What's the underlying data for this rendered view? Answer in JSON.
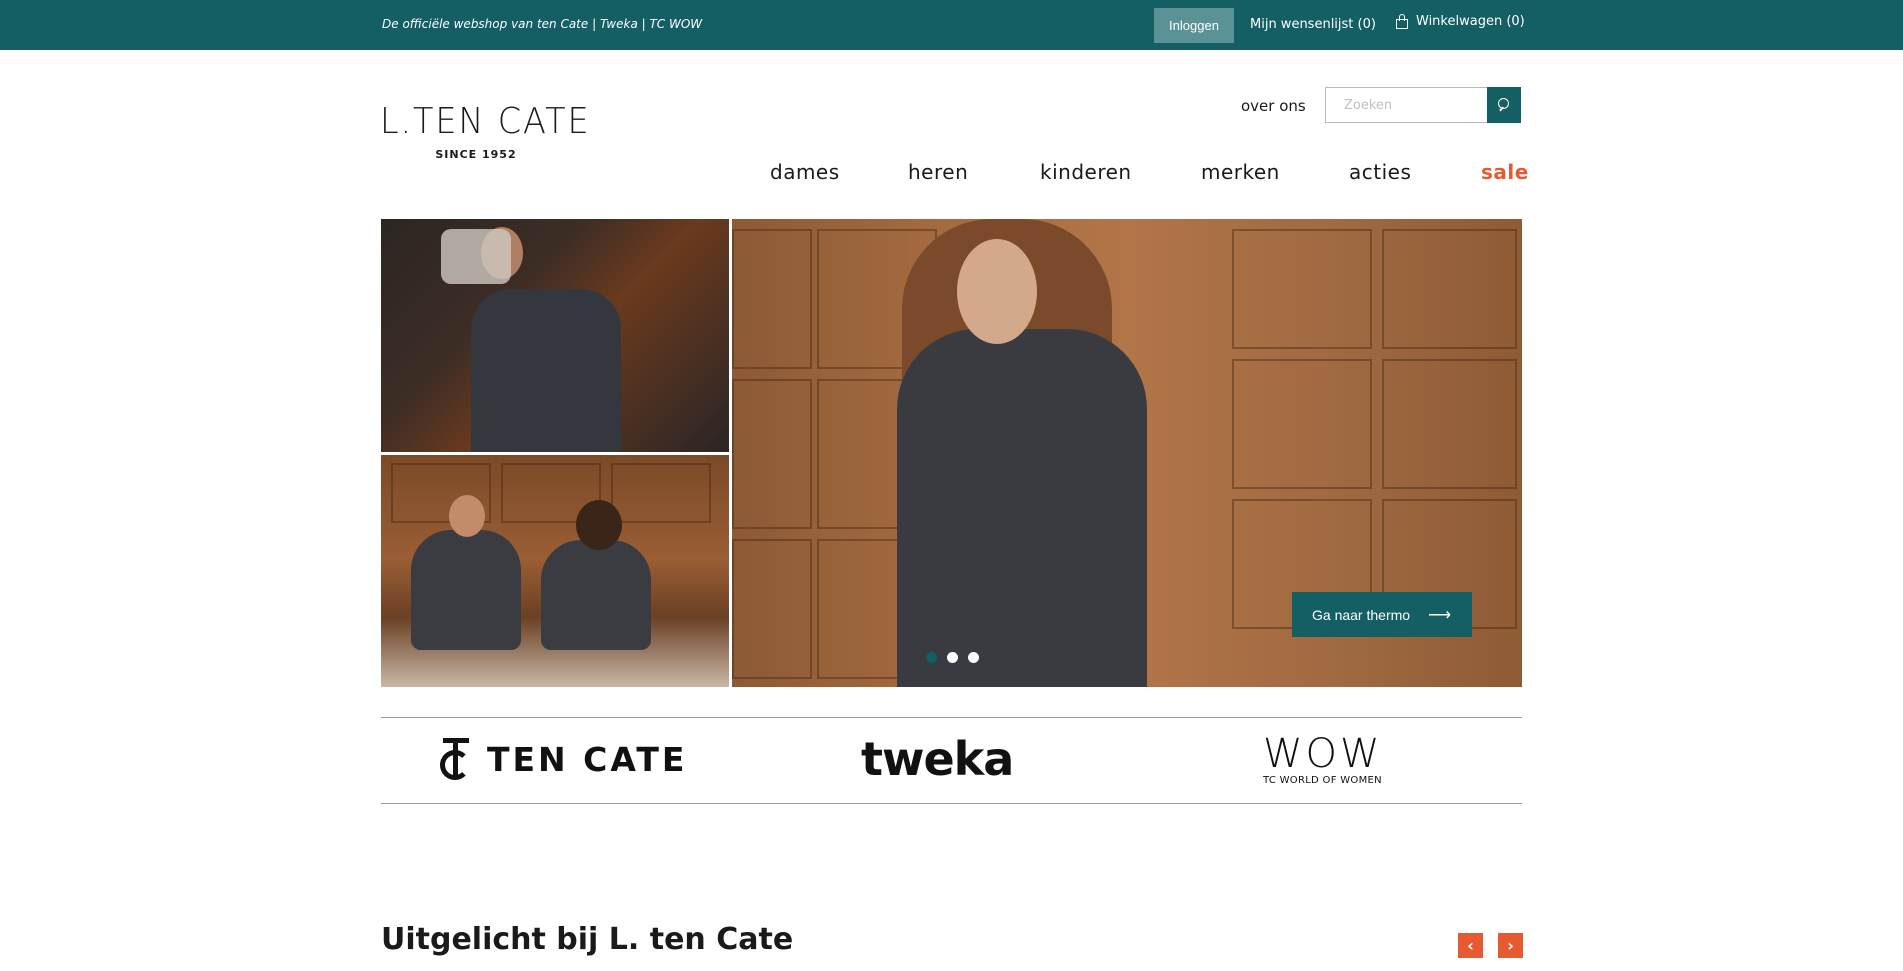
{
  "topbar": {
    "tagline": "De officiële webshop van ten Cate | Tweka | TC WOW",
    "login_label": "Inloggen",
    "wishlist_label": "Mijn wensenlijst (0)",
    "cart_label": "Winkelwagen (0)"
  },
  "header": {
    "logo_brand": "L.TEN CATE",
    "logo_since": "SINCE 1952",
    "about_label": "over ons",
    "search_placeholder": "Zoeken"
  },
  "nav": {
    "items": [
      {
        "label": "dames"
      },
      {
        "label": "heren"
      },
      {
        "label": "kinderen"
      },
      {
        "label": "merken"
      },
      {
        "label": "acties"
      },
      {
        "label": "sale"
      }
    ]
  },
  "hero": {
    "cta_label": "Ga naar thermo",
    "cta_arrow": "⟶",
    "slides_total": 3,
    "active_slide": 1
  },
  "brands": {
    "tencate_text": "TEN CATE",
    "tweka_text": "tweka",
    "wow_big": "WOW",
    "wow_small": "TC WORLD OF WOMEN"
  },
  "featured": {
    "title": "Uitgelicht bij L. ten Cate",
    "prev_label": "‹",
    "next_label": "›"
  },
  "colors": {
    "primary_teal": "#135f63",
    "accent_orange": "#e65a32"
  }
}
